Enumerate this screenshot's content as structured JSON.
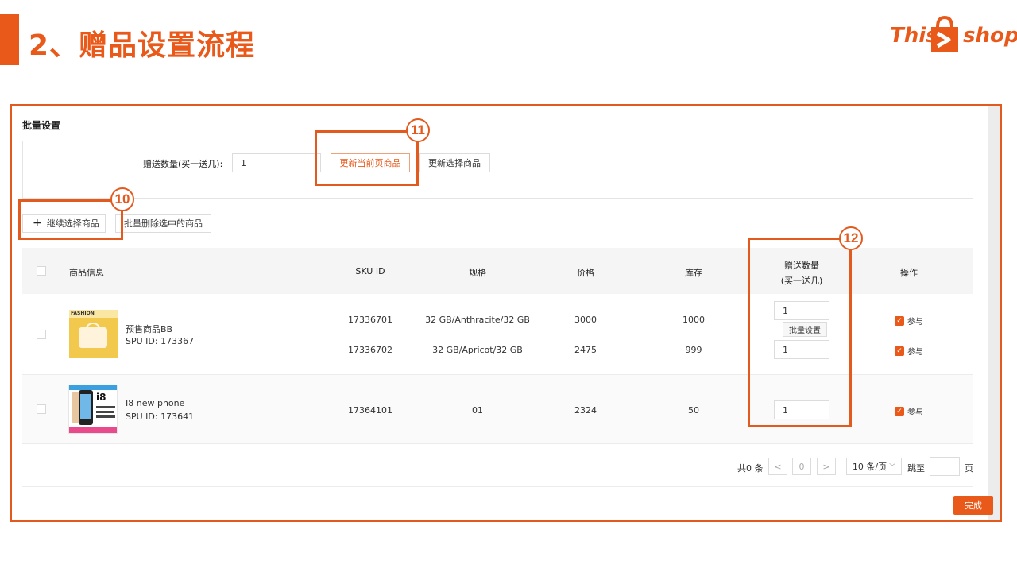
{
  "slide": {
    "title": "2、赠品设置流程",
    "logo_left": "This",
    "logo_right": "shop"
  },
  "batch": {
    "title": "批量设置",
    "gift_label": "赠送数量(买一送几):",
    "gift_value": "1",
    "update_page_btn": "更新当前页商品",
    "update_selected_btn": "更新选择商品"
  },
  "toolbar": {
    "add_label": "继续选择商品",
    "add_icon": "+",
    "delete_label": "批量删除选中的商品"
  },
  "callouts": {
    "c10": "10",
    "c11": "11",
    "c12": "12"
  },
  "table": {
    "headers": {
      "product": "商品信息",
      "sku": "SKU ID",
      "spec": "规格",
      "price": "价格",
      "stock": "库存",
      "gift_line1": "赠送数量",
      "gift_line2": "(买一送几)",
      "action": "操作"
    },
    "products": [
      {
        "name": "预售商品BB",
        "spu": "SPU ID: 173367",
        "image_text": "FASHION",
        "skus": [
          {
            "sku": "17336701",
            "spec": "32 GB/Anthracite/32 GB",
            "price": "3000",
            "stock": "1000",
            "gift": "1",
            "action": "参与"
          },
          {
            "sku": "17336702",
            "spec": "32 GB/Apricot/32 GB",
            "price": "2475",
            "stock": "999",
            "gift": "1",
            "action": "参与"
          }
        ],
        "batch_btn": "批量设置"
      },
      {
        "name": "I8 new phone",
        "spu": "SPU ID: 173641",
        "image_text": "i8",
        "skus": [
          {
            "sku": "17364101",
            "spec": "01",
            "price": "2324",
            "stock": "50",
            "gift": "1",
            "action": "参与"
          }
        ]
      }
    ]
  },
  "pagination": {
    "total": "共0 条",
    "prev": "<",
    "page": "0",
    "next": ">",
    "page_size": "10 条/页",
    "jump_label": "跳至",
    "page_unit": "页"
  },
  "footer": {
    "done_label": "完成"
  },
  "colors": {
    "accent": "#e8591a",
    "callout": "#e35a1f"
  }
}
